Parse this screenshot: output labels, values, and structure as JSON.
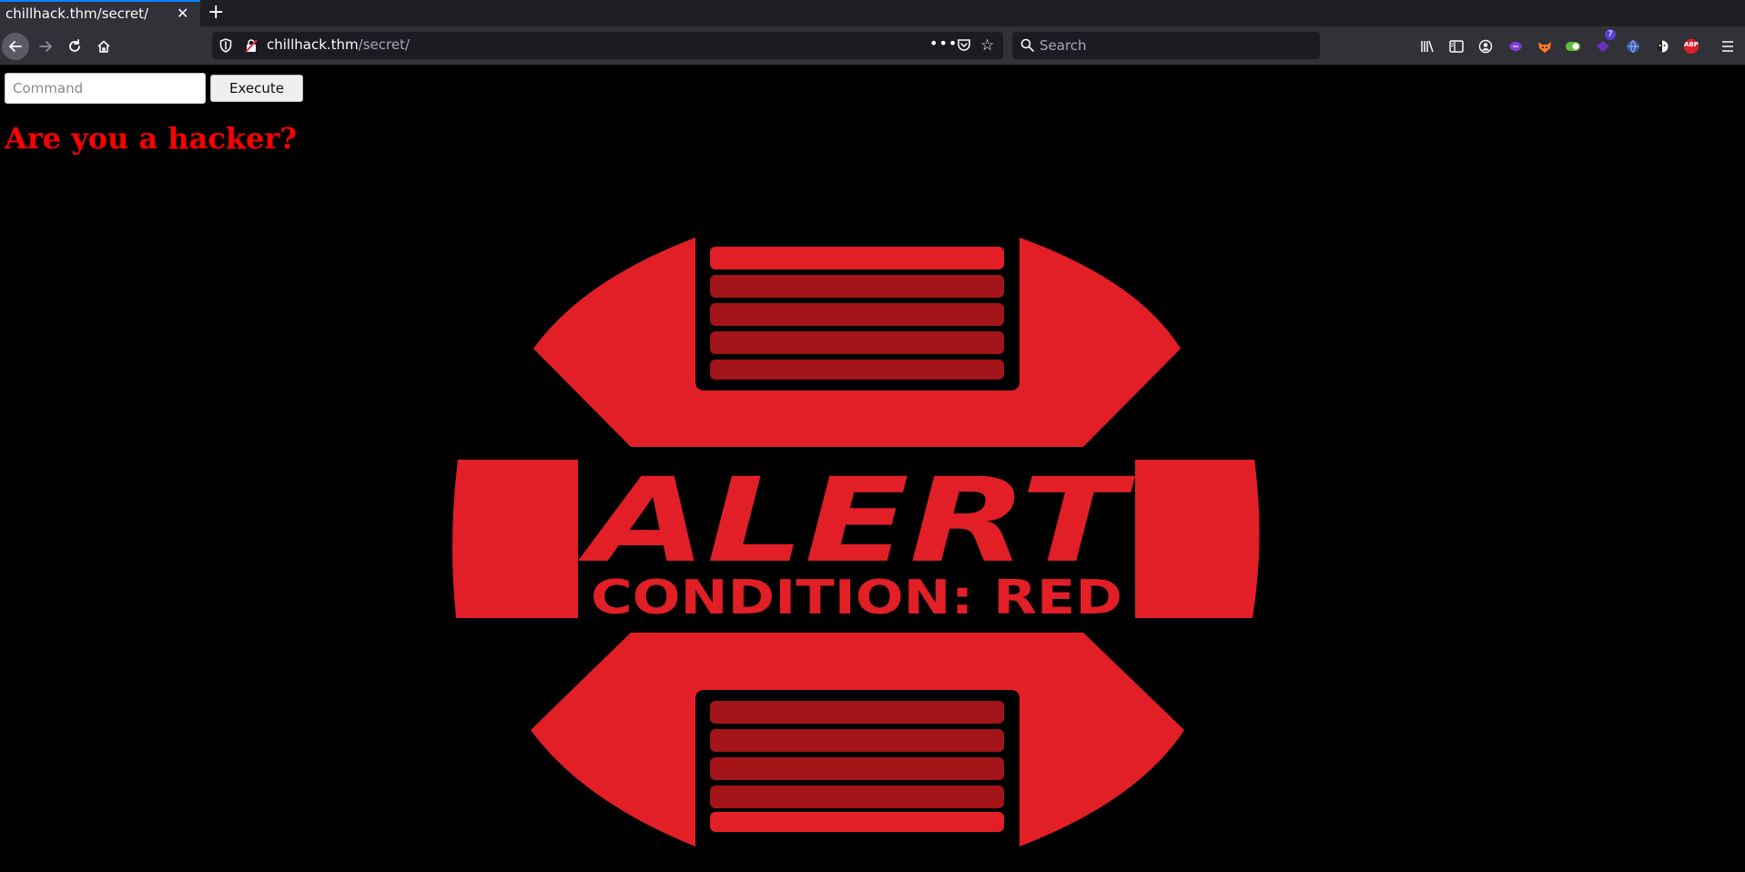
{
  "browser": {
    "tab_title": "chillhack.thm/secret/",
    "url_host": "chillhack.thm",
    "url_path": "/secret/",
    "search_placeholder": "Search",
    "extension_badge": "7",
    "abp_label": "ABP"
  },
  "page": {
    "command_placeholder": "Command",
    "execute_label": "Execute",
    "heading": "Are you a hacker?",
    "alert_logo": {
      "title": "ALERT",
      "subtitle": "CONDITION: RED"
    }
  },
  "colors": {
    "alert_red": "#e21f26",
    "alert_dark_red": "#a31519",
    "heading_red": "#ff0000",
    "page_background": "#000000"
  }
}
